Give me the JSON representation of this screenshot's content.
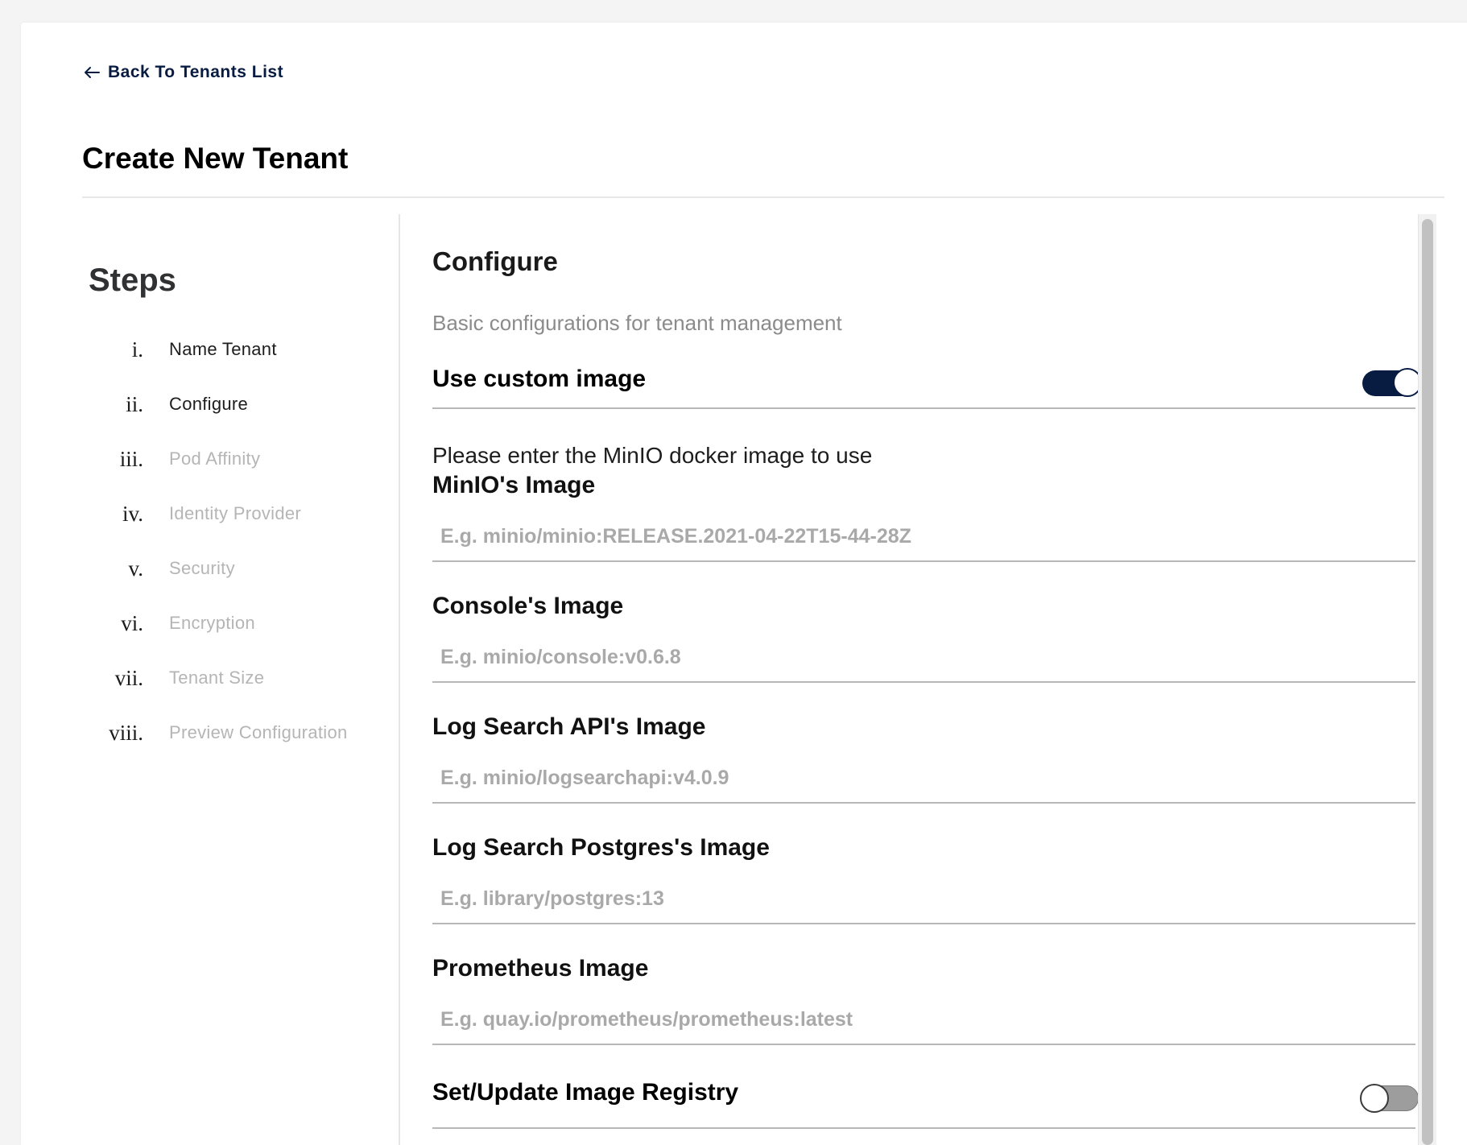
{
  "nav": {
    "back_label": "Back To Tenants List",
    "back_icon": "arrow-left-icon"
  },
  "page": {
    "title": "Create New Tenant"
  },
  "steps": {
    "title": "Steps",
    "items": [
      {
        "num": "i.",
        "label": "Name Tenant",
        "enabled": true
      },
      {
        "num": "ii.",
        "label": "Configure",
        "enabled": true
      },
      {
        "num": "iii.",
        "label": "Pod Affinity",
        "enabled": false
      },
      {
        "num": "iv.",
        "label": "Identity Provider",
        "enabled": false
      },
      {
        "num": "v.",
        "label": "Security",
        "enabled": false
      },
      {
        "num": "vi.",
        "label": "Encryption",
        "enabled": false
      },
      {
        "num": "vii.",
        "label": "Tenant Size",
        "enabled": false
      },
      {
        "num": "viii.",
        "label": "Preview Configuration",
        "enabled": false
      }
    ]
  },
  "configure": {
    "title": "Configure",
    "description": "Basic configurations for tenant management",
    "custom_image": {
      "label": "Use custom image",
      "enabled": true
    },
    "prompt": "Please enter the MinIO docker image to use",
    "fields": {
      "minio_image": {
        "label": "MinIO's Image",
        "placeholder": "E.g. minio/minio:RELEASE.2021-04-22T15-44-28Z",
        "value": ""
      },
      "console_image": {
        "label": "Console's Image",
        "placeholder": "E.g. minio/console:v0.6.8",
        "value": ""
      },
      "logsearch_api_image": {
        "label": "Log Search API's Image",
        "placeholder": "E.g. minio/logsearchapi:v4.0.9",
        "value": ""
      },
      "logsearch_postgres_image": {
        "label": "Log Search Postgres's Image",
        "placeholder": "E.g. library/postgres:13",
        "value": ""
      },
      "prometheus_image": {
        "label": "Prometheus Image",
        "placeholder": "E.g. quay.io/prometheus/prometheus:latest",
        "value": ""
      }
    },
    "image_registry": {
      "label": "Set/Update Image Registry",
      "enabled": false
    }
  },
  "colors": {
    "accent": "#081c42",
    "disabled_text": "#b5b5b5",
    "placeholder_text": "#a9a9a9"
  }
}
